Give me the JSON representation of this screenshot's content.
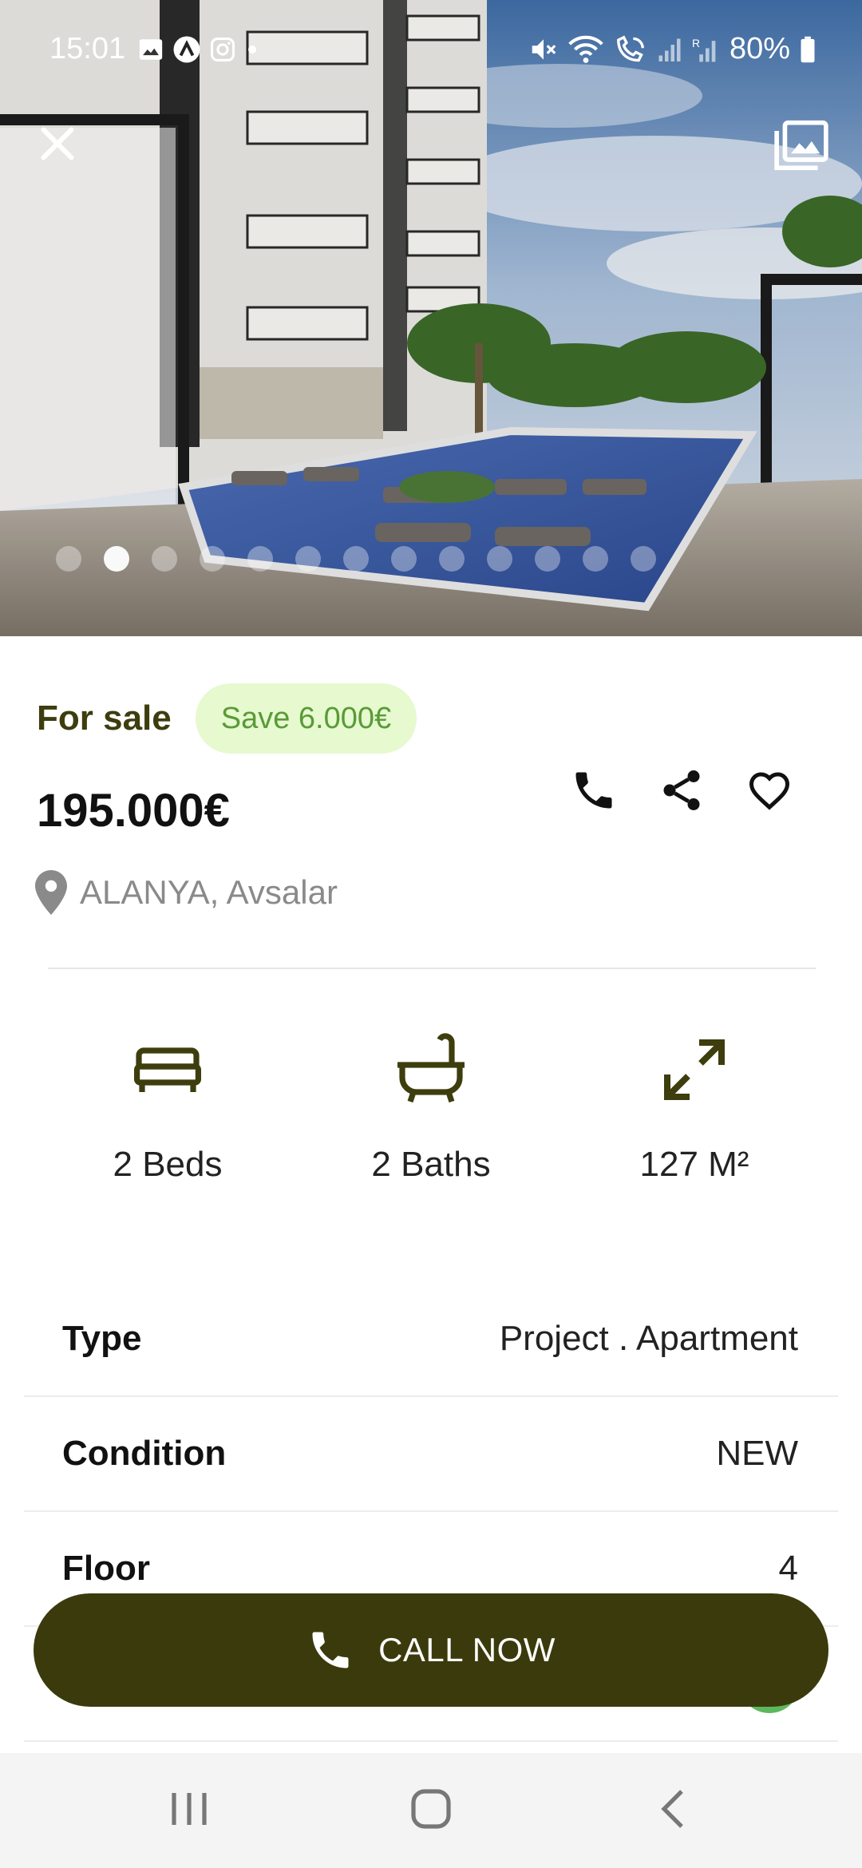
{
  "status_bar": {
    "time": "15:01",
    "battery": "80%",
    "notification_icons": [
      "gallery-icon",
      "app-icon",
      "instagram-icon",
      "dot-icon"
    ],
    "system_icons": [
      "mute-icon",
      "wifi-icon",
      "wifi-call-icon",
      "signal-icon",
      "signal-2-icon",
      "battery-icon"
    ]
  },
  "hero": {
    "close_icon": "close-icon",
    "gallery_icon": "gallery-icon",
    "pager": {
      "count": 13,
      "active_index": 1
    }
  },
  "listing": {
    "status": "For sale",
    "save_badge": "Save 6.000€",
    "price": "195.000€",
    "location": "ALANYA, Avsalar",
    "actions": [
      "phone-icon",
      "share-icon",
      "heart-icon"
    ]
  },
  "features": [
    {
      "icon": "bed-icon",
      "label": "2 Beds"
    },
    {
      "icon": "bath-icon",
      "label": "2 Baths"
    },
    {
      "icon": "area-icon",
      "label": "127 M²"
    }
  ],
  "details": [
    {
      "key": "Type",
      "value": "Project . Apartment"
    },
    {
      "key": "Condition",
      "value": "NEW"
    },
    {
      "key": "Floor",
      "value": "4"
    }
  ],
  "cta": {
    "label": "CALL NOW",
    "icon": "phone-icon"
  },
  "colors": {
    "brand_dark": "#3b3a0c",
    "for_sale_text": "#3d3d0e",
    "save_bg": "#e6f9cf",
    "save_text": "#5a9a38"
  },
  "nav_bar": [
    "recent-apps-icon",
    "home-icon",
    "back-icon"
  ]
}
